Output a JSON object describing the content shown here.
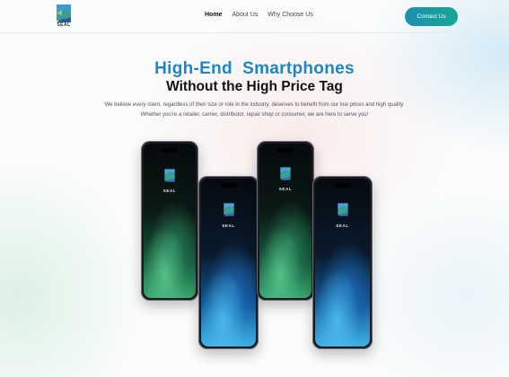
{
  "brand": {
    "name": "SEAL",
    "logo_text": "SEAL"
  },
  "nav": {
    "items": [
      {
        "label": "Home",
        "active": true
      },
      {
        "label": "About Us",
        "active": false
      },
      {
        "label": "Why Choose Us",
        "active": false
      }
    ],
    "cta_label": "Contact Us"
  },
  "hero": {
    "title_line1": "High-End  Smartphones",
    "title_line2": "Without the High Price Tag",
    "description": "We believe every client, regardless of their size or role in the industry, deserves to benefit from our low prices and high quality. Whether you're a retailer, carrier, distributor, repair shop or consumer, we are here to serve you!"
  },
  "phones": [
    {
      "screen_logo": "SEAL",
      "theme": "green"
    },
    {
      "screen_logo": "SEAL",
      "theme": "blue"
    },
    {
      "screen_logo": "SEAL",
      "theme": "green"
    },
    {
      "screen_logo": "SEAL",
      "theme": "blue"
    }
  ],
  "colors": {
    "accent_blue": "#1d86c4",
    "cta_gradient_start": "#1e8fb1",
    "cta_gradient_end": "#17a695"
  }
}
